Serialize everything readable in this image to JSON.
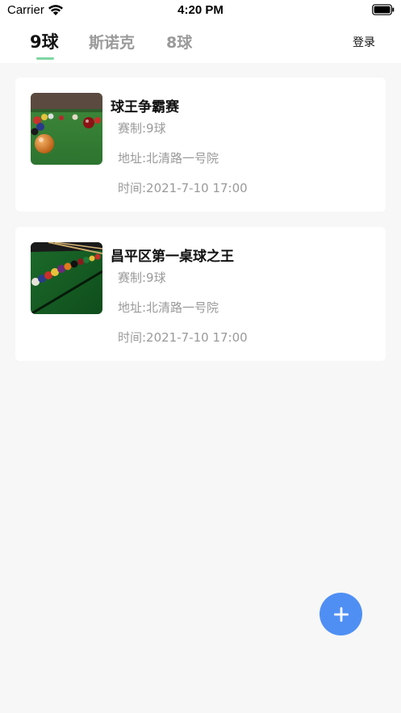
{
  "status_bar": {
    "carrier": "Carrier",
    "time": "4:20 PM",
    "wifi_icon": "wifi-icon",
    "battery_icon": "battery-icon"
  },
  "tabs": [
    {
      "label": "9球",
      "active": true
    },
    {
      "label": "斯诺克",
      "active": false
    },
    {
      "label": "8球",
      "active": false
    }
  ],
  "header": {
    "login_label": "登录"
  },
  "events": [
    {
      "title": "球王争霸赛",
      "format": "赛制:9球",
      "address": "地址:北清路一号院",
      "time": "时间:2021-7-10 17:00",
      "thumbnail": "billiard-balls-photo"
    },
    {
      "title": "昌平区第一桌球之王",
      "format": "赛制:9球",
      "address": "地址:北清路一号院",
      "time": "时间:2021-7-10 17:00",
      "thumbnail": "billiard-rack-photo"
    }
  ],
  "fab": {
    "icon": "plus-icon"
  },
  "colors": {
    "accent": "#4f8ff4",
    "tab_indicator": "#7fd6a1",
    "muted_text": "#9a9a9a",
    "background": "#f7f7f7"
  }
}
